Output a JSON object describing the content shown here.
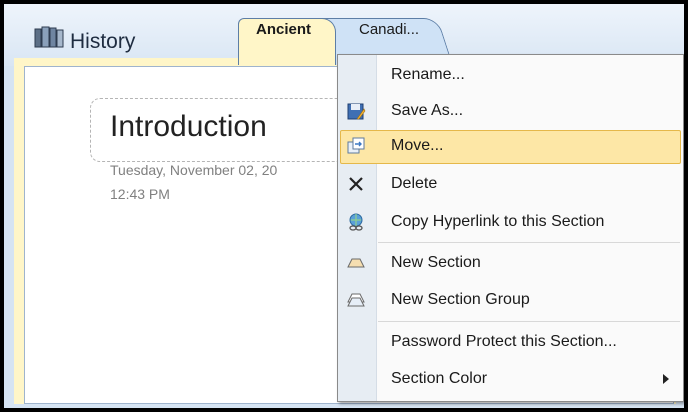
{
  "notebook": {
    "title": "History"
  },
  "tabs": [
    {
      "label": "Ancient",
      "active": true
    },
    {
      "label": "Canadi..."
    }
  ],
  "page": {
    "title": "Introduction",
    "date": "Tuesday, November  02, 20",
    "time": "12:43 PM"
  },
  "context_menu": {
    "items": [
      {
        "label": "Rename...",
        "icon": "none"
      },
      {
        "label": "Save As...",
        "icon": "save-as-icon"
      },
      {
        "label": "Move...",
        "icon": "move-icon",
        "highlighted": true
      },
      {
        "label": "Delete",
        "icon": "delete-x-icon"
      },
      {
        "label": "Copy Hyperlink to this Section",
        "icon": "hyperlink-icon"
      },
      {
        "label": "New Section",
        "icon": "new-section-icon"
      },
      {
        "label": "New Section Group",
        "icon": "new-section-group-icon"
      },
      {
        "label": "Password Protect this Section...",
        "icon": "none"
      },
      {
        "label": "Section Color",
        "icon": "none",
        "submenu": true
      }
    ]
  },
  "colors": {
    "highlight": "#fde7a6",
    "tab_active": "#fff6c8",
    "tab_inactive": "#cfe2f6"
  }
}
